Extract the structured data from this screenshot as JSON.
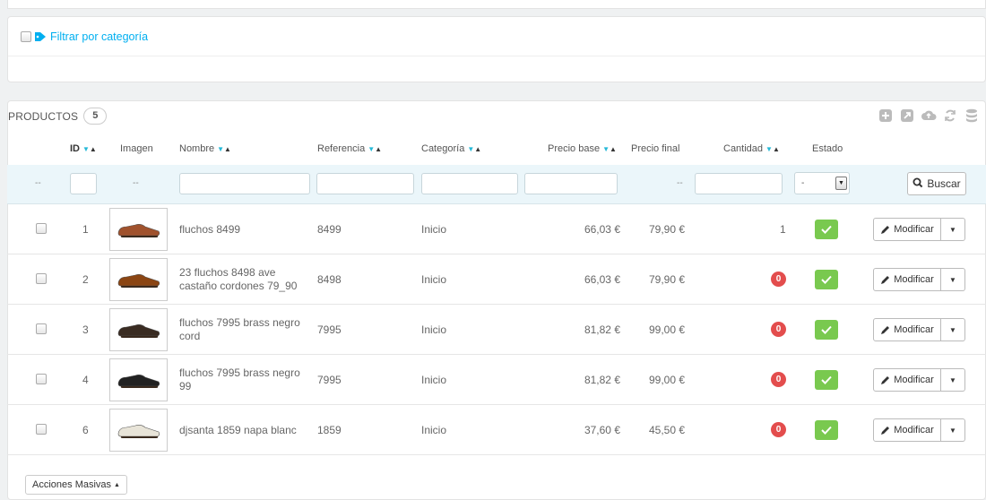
{
  "category_filter": {
    "label": "Filtrar por categoría"
  },
  "products_panel": {
    "title": "PRODUCTOS",
    "count": "5",
    "toolbar_icons": [
      "add-icon",
      "export-icon",
      "upload-icon",
      "refresh-icon",
      "database-icon"
    ]
  },
  "columns": {
    "id": "ID",
    "image": "Imagen",
    "name": "Nombre",
    "reference": "Referencia",
    "category": "Categoría",
    "base_price": "Precio base",
    "final_price": "Precio final",
    "quantity": "Cantidad",
    "status": "Estado"
  },
  "filters": {
    "dash": "--",
    "status_select": "-",
    "search_label": "Buscar"
  },
  "rows": [
    {
      "id": "1",
      "name": "fluchos 8499",
      "reference": "8499",
      "category": "Inicio",
      "base_price": "66,03 €",
      "final_price": "79,90 €",
      "quantity": "1",
      "shoe_color": "#a0522d"
    },
    {
      "id": "2",
      "name": "23 fluchos 8498 ave castaño cordones 79_90",
      "reference": "8498",
      "category": "Inicio",
      "base_price": "66,03 €",
      "final_price": "79,90 €",
      "quantity": "0",
      "shoe_color": "#8b4513"
    },
    {
      "id": "3",
      "name": "fluchos 7995 brass negro cord",
      "reference": "7995",
      "category": "Inicio",
      "base_price": "81,82 €",
      "final_price": "99,00 €",
      "quantity": "0",
      "shoe_color": "#3a2c22"
    },
    {
      "id": "4",
      "name": "fluchos 7995 brass negro 99",
      "reference": "7995",
      "category": "Inicio",
      "base_price": "81,82 €",
      "final_price": "99,00 €",
      "quantity": "0",
      "shoe_color": "#222222"
    },
    {
      "id": "6",
      "name": "djsanta 1859 napa blanc",
      "reference": "1859",
      "category": "Inicio",
      "base_price": "37,60 €",
      "final_price": "45,50 €",
      "quantity": "0",
      "shoe_color": "#e8e4d8"
    }
  ],
  "row_actions": {
    "edit_label": "Modificar"
  },
  "bulk_actions": {
    "label": "Acciones Masivas"
  },
  "colors": {
    "accent": "#25b9d7",
    "link": "#00aff0",
    "status_ok": "#79c94f",
    "zero_badge": "#e34d4d",
    "filter_row_bg": "#ebf6fa"
  }
}
